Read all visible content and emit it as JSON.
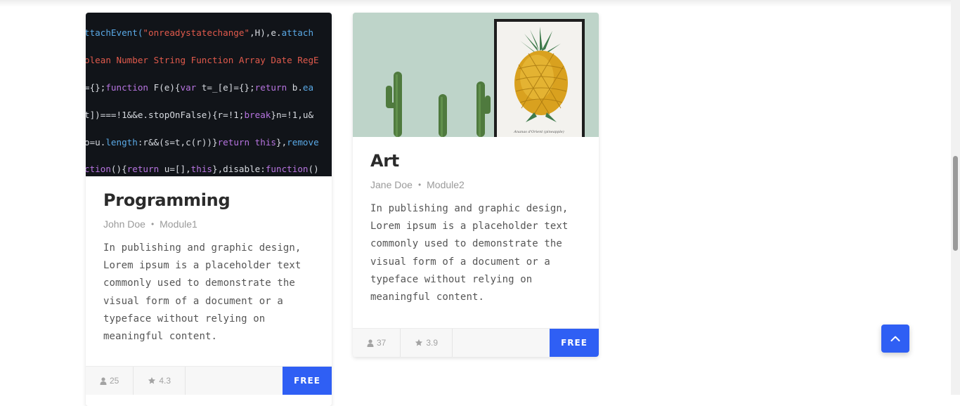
{
  "courses": [
    {
      "title": "Programming",
      "author": "John Doe",
      "module": "Module1",
      "description": "In publishing and graphic design, Lorem ipsum is a placeholder text commonly used to demonstrate the visual form of a document or a typeface without relying on meaningful content.",
      "students": "25",
      "rating": "4.3",
      "price_label": "FREE",
      "image": "code-screen-image"
    },
    {
      "title": "Art",
      "author": "Jane Doe",
      "module": "Module2",
      "description": "In publishing and graphic design, Lorem ipsum is a placeholder text commonly used to demonstrate the visual form of a document or a typeface without relying on meaningful content.",
      "students": "37",
      "rating": "3.9",
      "price_label": "FREE",
      "image": "cactus-pineapple-image"
    }
  ],
  "image_captions": {
    "pineapple_print": "Ananas d'Orient (pineapple)"
  },
  "icons": {
    "students": "user-icon",
    "rating": "star-icon",
    "back_to_top": "chevron-up-icon"
  },
  "colors": {
    "accent": "#2f5ff4",
    "title": "#2b2b2b",
    "meta": "#9a9a9a",
    "footer_bg": "#f7f7f7"
  }
}
